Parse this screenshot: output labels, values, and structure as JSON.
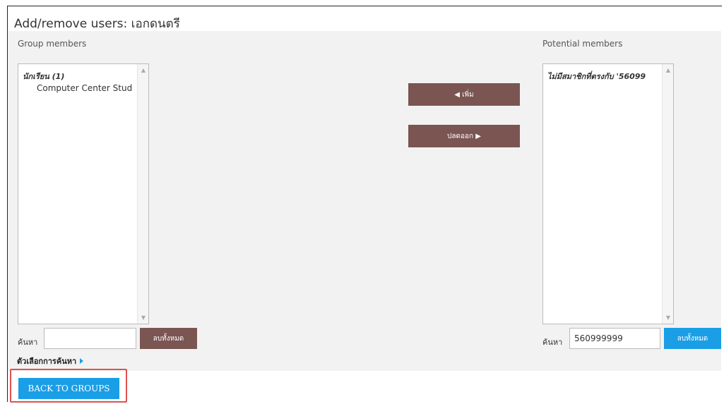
{
  "page": {
    "title": "Add/remove users: เอกดนตรี"
  },
  "group_members": {
    "label": "Group members",
    "group_label": "นักเรียน (1)",
    "options": [
      "Computer Center Stud"
    ],
    "search_label": "ค้นหา",
    "search_value": "",
    "clear_button": "ลบทั้งหมด"
  },
  "actions": {
    "add_button": "◀ เพิ่ม",
    "remove_button": "ปลดออก ▶"
  },
  "potential_members": {
    "label": "Potential members",
    "group_label": "ไม่มีสมาชิกที่ตรงกับ '56099",
    "search_label": "ค้นหา",
    "search_value": "560999999",
    "clear_button": "ลบทั้งหมด"
  },
  "search_options": {
    "label": "ตัวเลือกการค้นหา"
  },
  "footer": {
    "back_button": "BACK TO GROUPS"
  },
  "colors": {
    "brown_button": "#7a5552",
    "blue_button": "#1a9ee6",
    "highlight": "#e05050",
    "panel_bg": "#f2f2f2"
  }
}
